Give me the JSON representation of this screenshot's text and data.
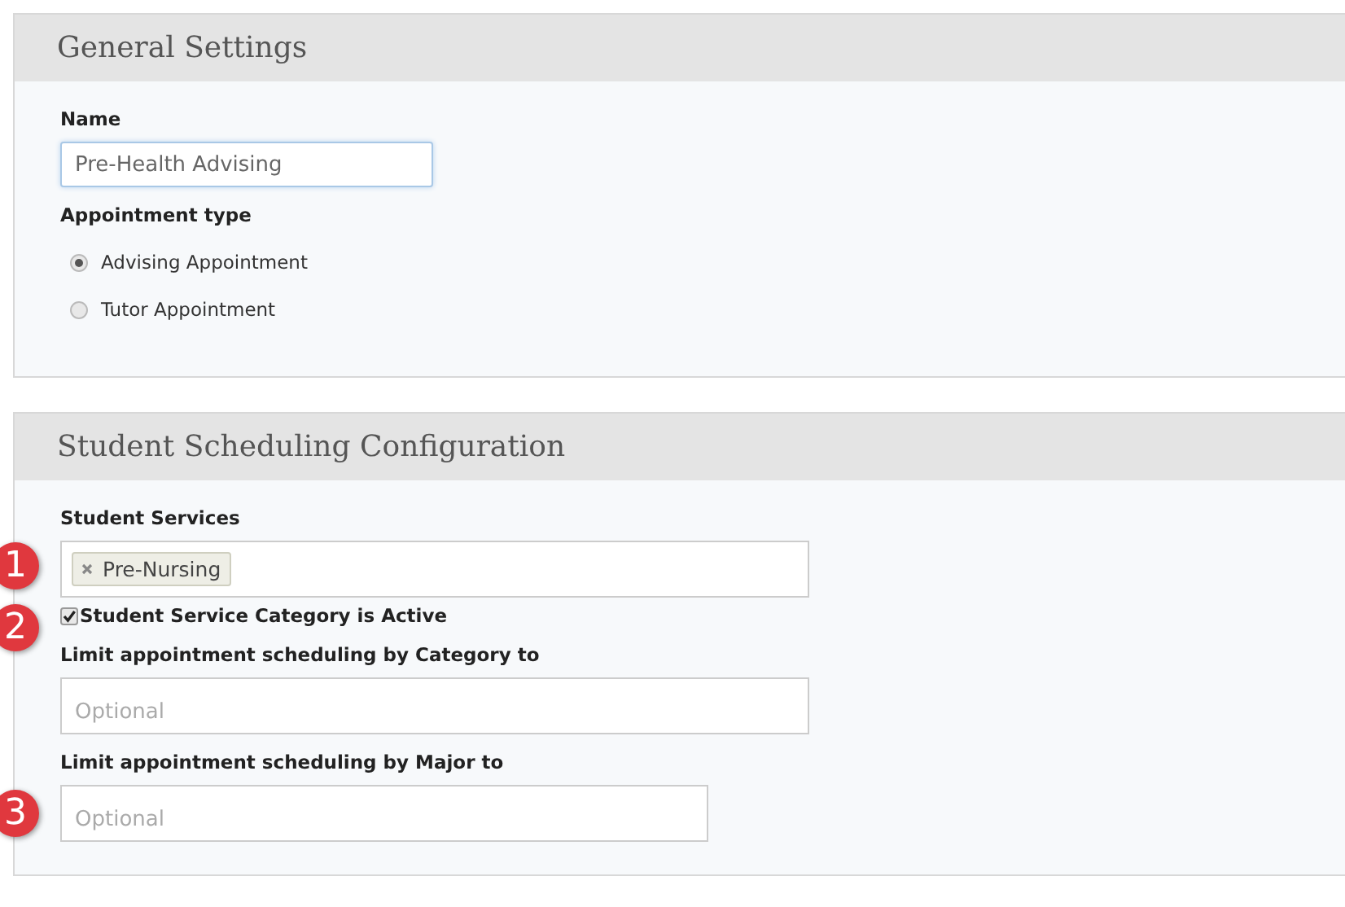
{
  "sections": [
    {
      "title": "General Settings",
      "fields": [
        {
          "kind": "text",
          "label": "Name",
          "value": "Pre-Health Advising",
          "focused": true
        },
        {
          "kind": "radio",
          "label": "Appointment type",
          "options": [
            {
              "label": "Advising Appointment",
              "selected": true
            },
            {
              "label": "Tutor Appointment",
              "selected": false
            }
          ]
        }
      ]
    },
    {
      "title": "Student Scheduling Configuration",
      "fields": [
        {
          "kind": "tags",
          "label": "Student Services",
          "marker": "1",
          "tags": [
            {
              "label": "Pre-Nursing"
            }
          ]
        },
        {
          "kind": "checkbox",
          "label": "Student Service Category is Active",
          "checked": true,
          "marker": "2"
        },
        {
          "kind": "text",
          "label": "Limit appointment scheduling by Category to",
          "placeholder": "Optional"
        },
        {
          "kind": "text",
          "label": "Limit appointment scheduling by Major to",
          "placeholder": "Optional",
          "marker": "3"
        }
      ]
    }
  ]
}
